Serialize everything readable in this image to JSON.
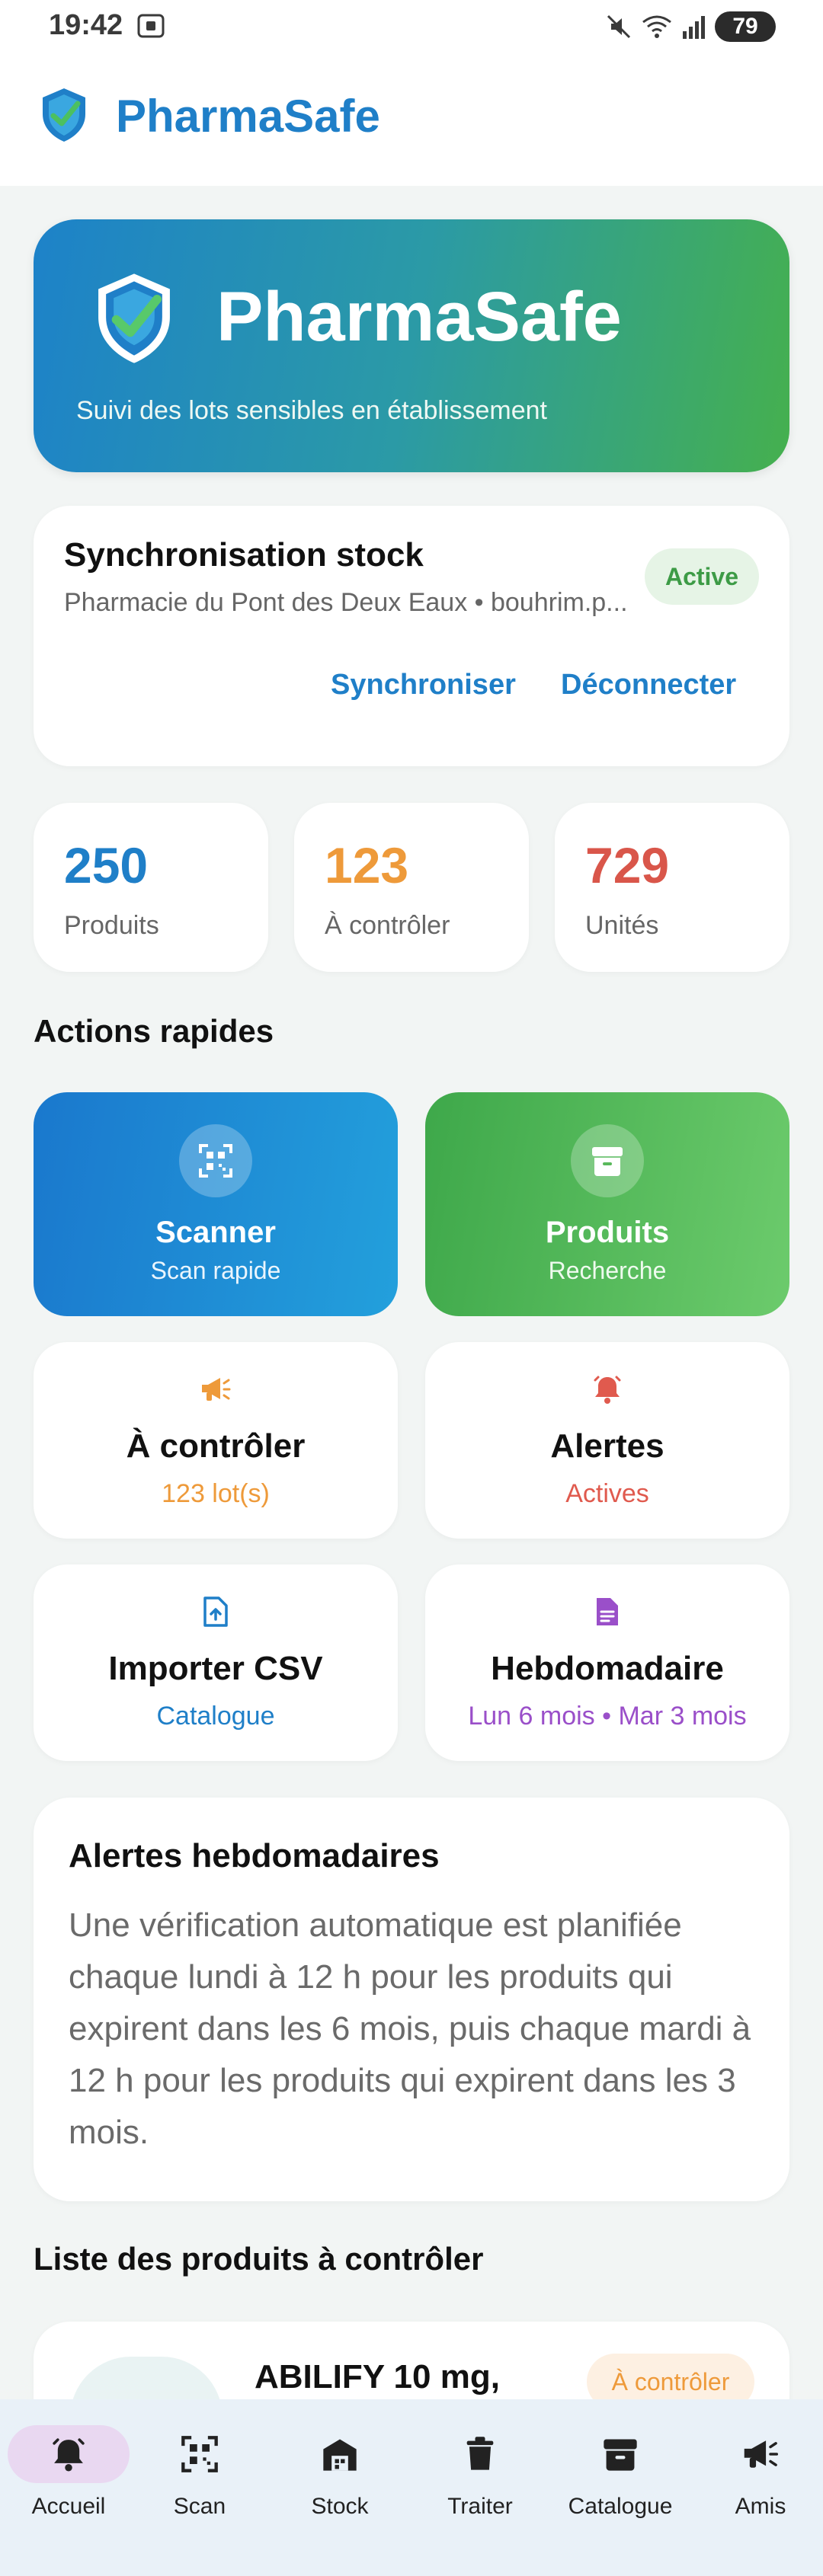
{
  "status_bar": {
    "time": "19:42",
    "battery": "79"
  },
  "app_bar": {
    "title": "PharmaSafe"
  },
  "hero": {
    "title": "PharmaSafe",
    "subtitle": "Suivi des lots sensibles en établissement"
  },
  "sync": {
    "title": "Synchronisation stock",
    "subtitle": "Pharmacie du Pont des Deux Eaux • bouhrim.p...",
    "status": "Active",
    "sync_label": "Synchroniser",
    "disconnect_label": "Déconnecter"
  },
  "stats": [
    {
      "value": "250",
      "label": "Produits",
      "color": "#1f7fc8"
    },
    {
      "value": "123",
      "label": "À contrôler",
      "color": "#ee9a3a"
    },
    {
      "value": "729",
      "label": "Unités",
      "color": "#d9564a"
    }
  ],
  "quick_actions": {
    "title": "Actions rapides",
    "scanner": {
      "title": "Scanner",
      "subtitle": "Scan rapide"
    },
    "products": {
      "title": "Produits",
      "subtitle": "Recherche"
    },
    "to_check": {
      "title": "À contrôler",
      "subtitle": "123 lot(s)",
      "color": "#ee9a3a"
    },
    "alerts": {
      "title": "Alertes",
      "subtitle": "Actives",
      "color": "#e05a4e"
    },
    "import_csv": {
      "title": "Importer CSV",
      "subtitle": "Catalogue",
      "color": "#1f7fc8"
    },
    "weekly": {
      "title": "Hebdomadaire",
      "subtitle": "Lun 6 mois • Mar 3 mois",
      "color": "#9a4fc9"
    }
  },
  "weekly_alerts": {
    "title": "Alertes hebdomadaires",
    "body": "Une vérification automatique est planifiée chaque lundi à 12 h pour les produits qui expirent dans les 6 mois, puis chaque mardi à 12 h pour les produits qui expirent dans les 3 mois."
  },
  "product_list": {
    "title": "Liste des produits à contrôler",
    "items": [
      {
        "name": "ABILIFY 10 mg,",
        "badge": "À contrôler"
      }
    ]
  },
  "bottom_nav": [
    {
      "label": "Accueil",
      "icon": "bell-icon",
      "active": true
    },
    {
      "label": "Scan",
      "icon": "qr-scan-icon"
    },
    {
      "label": "Stock",
      "icon": "warehouse-icon"
    },
    {
      "label": "Traiter",
      "icon": "trash-icon"
    },
    {
      "label": "Catalogue",
      "icon": "archive-box-icon"
    },
    {
      "label": "Amis",
      "icon": "megaphone-icon"
    }
  ]
}
